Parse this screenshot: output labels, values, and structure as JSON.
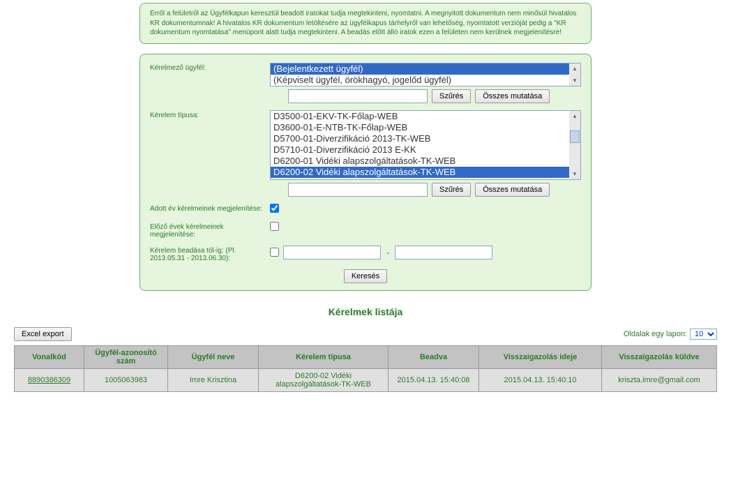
{
  "info_text": "Erről a felületről az Ügyfélkapun keresztül beadott iratokat tudja megtekinteni, nyomtatni. A megnyitott dokumentum nem minősül hivatalos KR dokumentumnak! A hivatalos KR dokumentum letöltésére az ügyfélkapus tárhelyről van lehetőség, nyomtatott verzióját pedig a \"KR dokumentum nyomtatása\" menüpont alatt tudja megtekinteni. A beadás előtt álló iratok ezen a felületen nem kerülnek megjelenítésre!",
  "form": {
    "customer_label": "Kérelmező ügyfél:",
    "customer_options": [
      "(Bejelentkezett ügyfél)",
      "(Képviselt ügyfél, örökhagyó, jogelőd ügyfél)"
    ],
    "customer_selected_index": 0,
    "filter1_value": "",
    "filter_btn": "Szűrés",
    "showall_btn": "Összes mutatása",
    "type_label": "Kérelem típusa:",
    "type_options": [
      "D3500-01-EKV-TK-Főlap-WEB",
      "D3600-01-E-NTB-TK-Főlap-WEB",
      "D5700-01-Diverzifikáció 2013-TK-WEB",
      "D5710-01-Diverzifikáció 2013 E-KK",
      "D6200-01 Vidéki alapszolgáltatások-TK-WEB",
      "D6200-02 Vidéki alapszolgáltatások-TK-WEB"
    ],
    "type_selected_index": 5,
    "filter2_value": "",
    "current_year_label": "Adott év kérelmeinek megjelenítése:",
    "current_year_checked": true,
    "prev_years_label": "Előző évek kérelmeinek megjelenítése:",
    "prev_years_checked": false,
    "date_range_label": "Kérelem beadása tól-ig: (Pl. 2013.05.31 - 2013.06.30):",
    "date_range_checked": false,
    "date_from": "",
    "date_to": "",
    "search_btn": "Keresés"
  },
  "list_title": "Kérelmek listája",
  "excel_btn": "Excel export",
  "pager_label": "Oldalak egy lapon:",
  "pager_value": "10",
  "table": {
    "headers": {
      "barcode": "Vonalkód",
      "client_id": "Ügyfél-azonosító szám",
      "client_name": "Ügyfél neve",
      "req_type": "Kérelem típusa",
      "submitted": "Beadva",
      "ack_time": "Visszaigazolás ideje",
      "ack_sent": "Visszaigazolás küldve"
    },
    "row": {
      "barcode": "8890386309",
      "client_id": "1005063983",
      "client_name": "Imre Krisztina",
      "req_type": "D6200-02 Vidéki alapszolgáltatások-TK-WEB",
      "submitted": "2015.04.13. 15:40:08",
      "ack_time": "2015.04.13. 15:40:10",
      "ack_sent": "kriszta.imre@gmail.com"
    }
  }
}
